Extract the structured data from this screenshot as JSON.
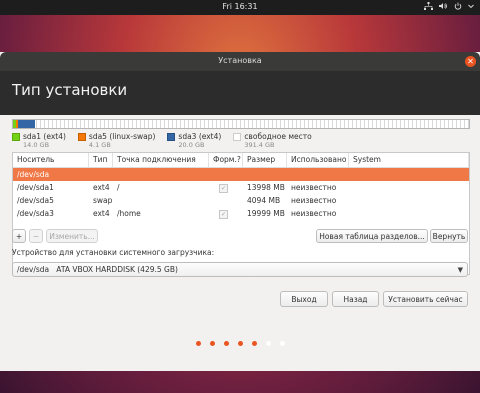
{
  "topbar": {
    "clock": "Fri 16:31"
  },
  "window": {
    "title": "Установка",
    "heading": "Тип установки"
  },
  "legend": [
    {
      "name": "sda1 (ext4)",
      "size": "14.0 GB",
      "color": "#73d216"
    },
    {
      "name": "sda5 (linux-swap)",
      "size": "4.1 GB",
      "color": "#f57900"
    },
    {
      "name": "sda3 (ext4)",
      "size": "20.0 GB",
      "color": "#3465a4"
    },
    {
      "name": "свободное место",
      "size": "391.4 GB",
      "color": "#ffffff"
    }
  ],
  "table": {
    "columns": [
      "Носитель",
      "Тип",
      "Точка подключения",
      "Форм.?",
      "Размер",
      "Использовано",
      "System"
    ],
    "rows": [
      {
        "device": "/dev/sda",
        "type": "",
        "mount": "",
        "format": false,
        "size": "",
        "used": "",
        "system": "",
        "selected": true
      },
      {
        "device": "/dev/sda1",
        "type": "ext4",
        "mount": "/",
        "format": true,
        "size": "13998 MB",
        "used": "неизвестно",
        "system": ""
      },
      {
        "device": "/dev/sda5",
        "type": "swap",
        "mount": "",
        "format": false,
        "size": "4094 MB",
        "used": "неизвестно",
        "system": ""
      },
      {
        "device": "/dev/sda3",
        "type": "ext4",
        "mount": "/home",
        "format": true,
        "size": "19999 MB",
        "used": "неизвестно",
        "system": ""
      }
    ]
  },
  "buttons": {
    "add": "+",
    "remove": "−",
    "change": "Изменить...",
    "new_table": "Новая таблица разделов...",
    "revert": "Вернуть",
    "quit": "Выход",
    "back": "Назад",
    "install": "Установить сейчас"
  },
  "boot": {
    "label": "Устройство для установки системного загрузчика:",
    "device": "/dev/sda",
    "description": "ATA VBOX HARDDISK (429.5 GB)"
  },
  "progress": {
    "total_steps": 7,
    "completed_steps": 5,
    "active_color": "#e95420",
    "inactive_color": "#ffffff"
  }
}
